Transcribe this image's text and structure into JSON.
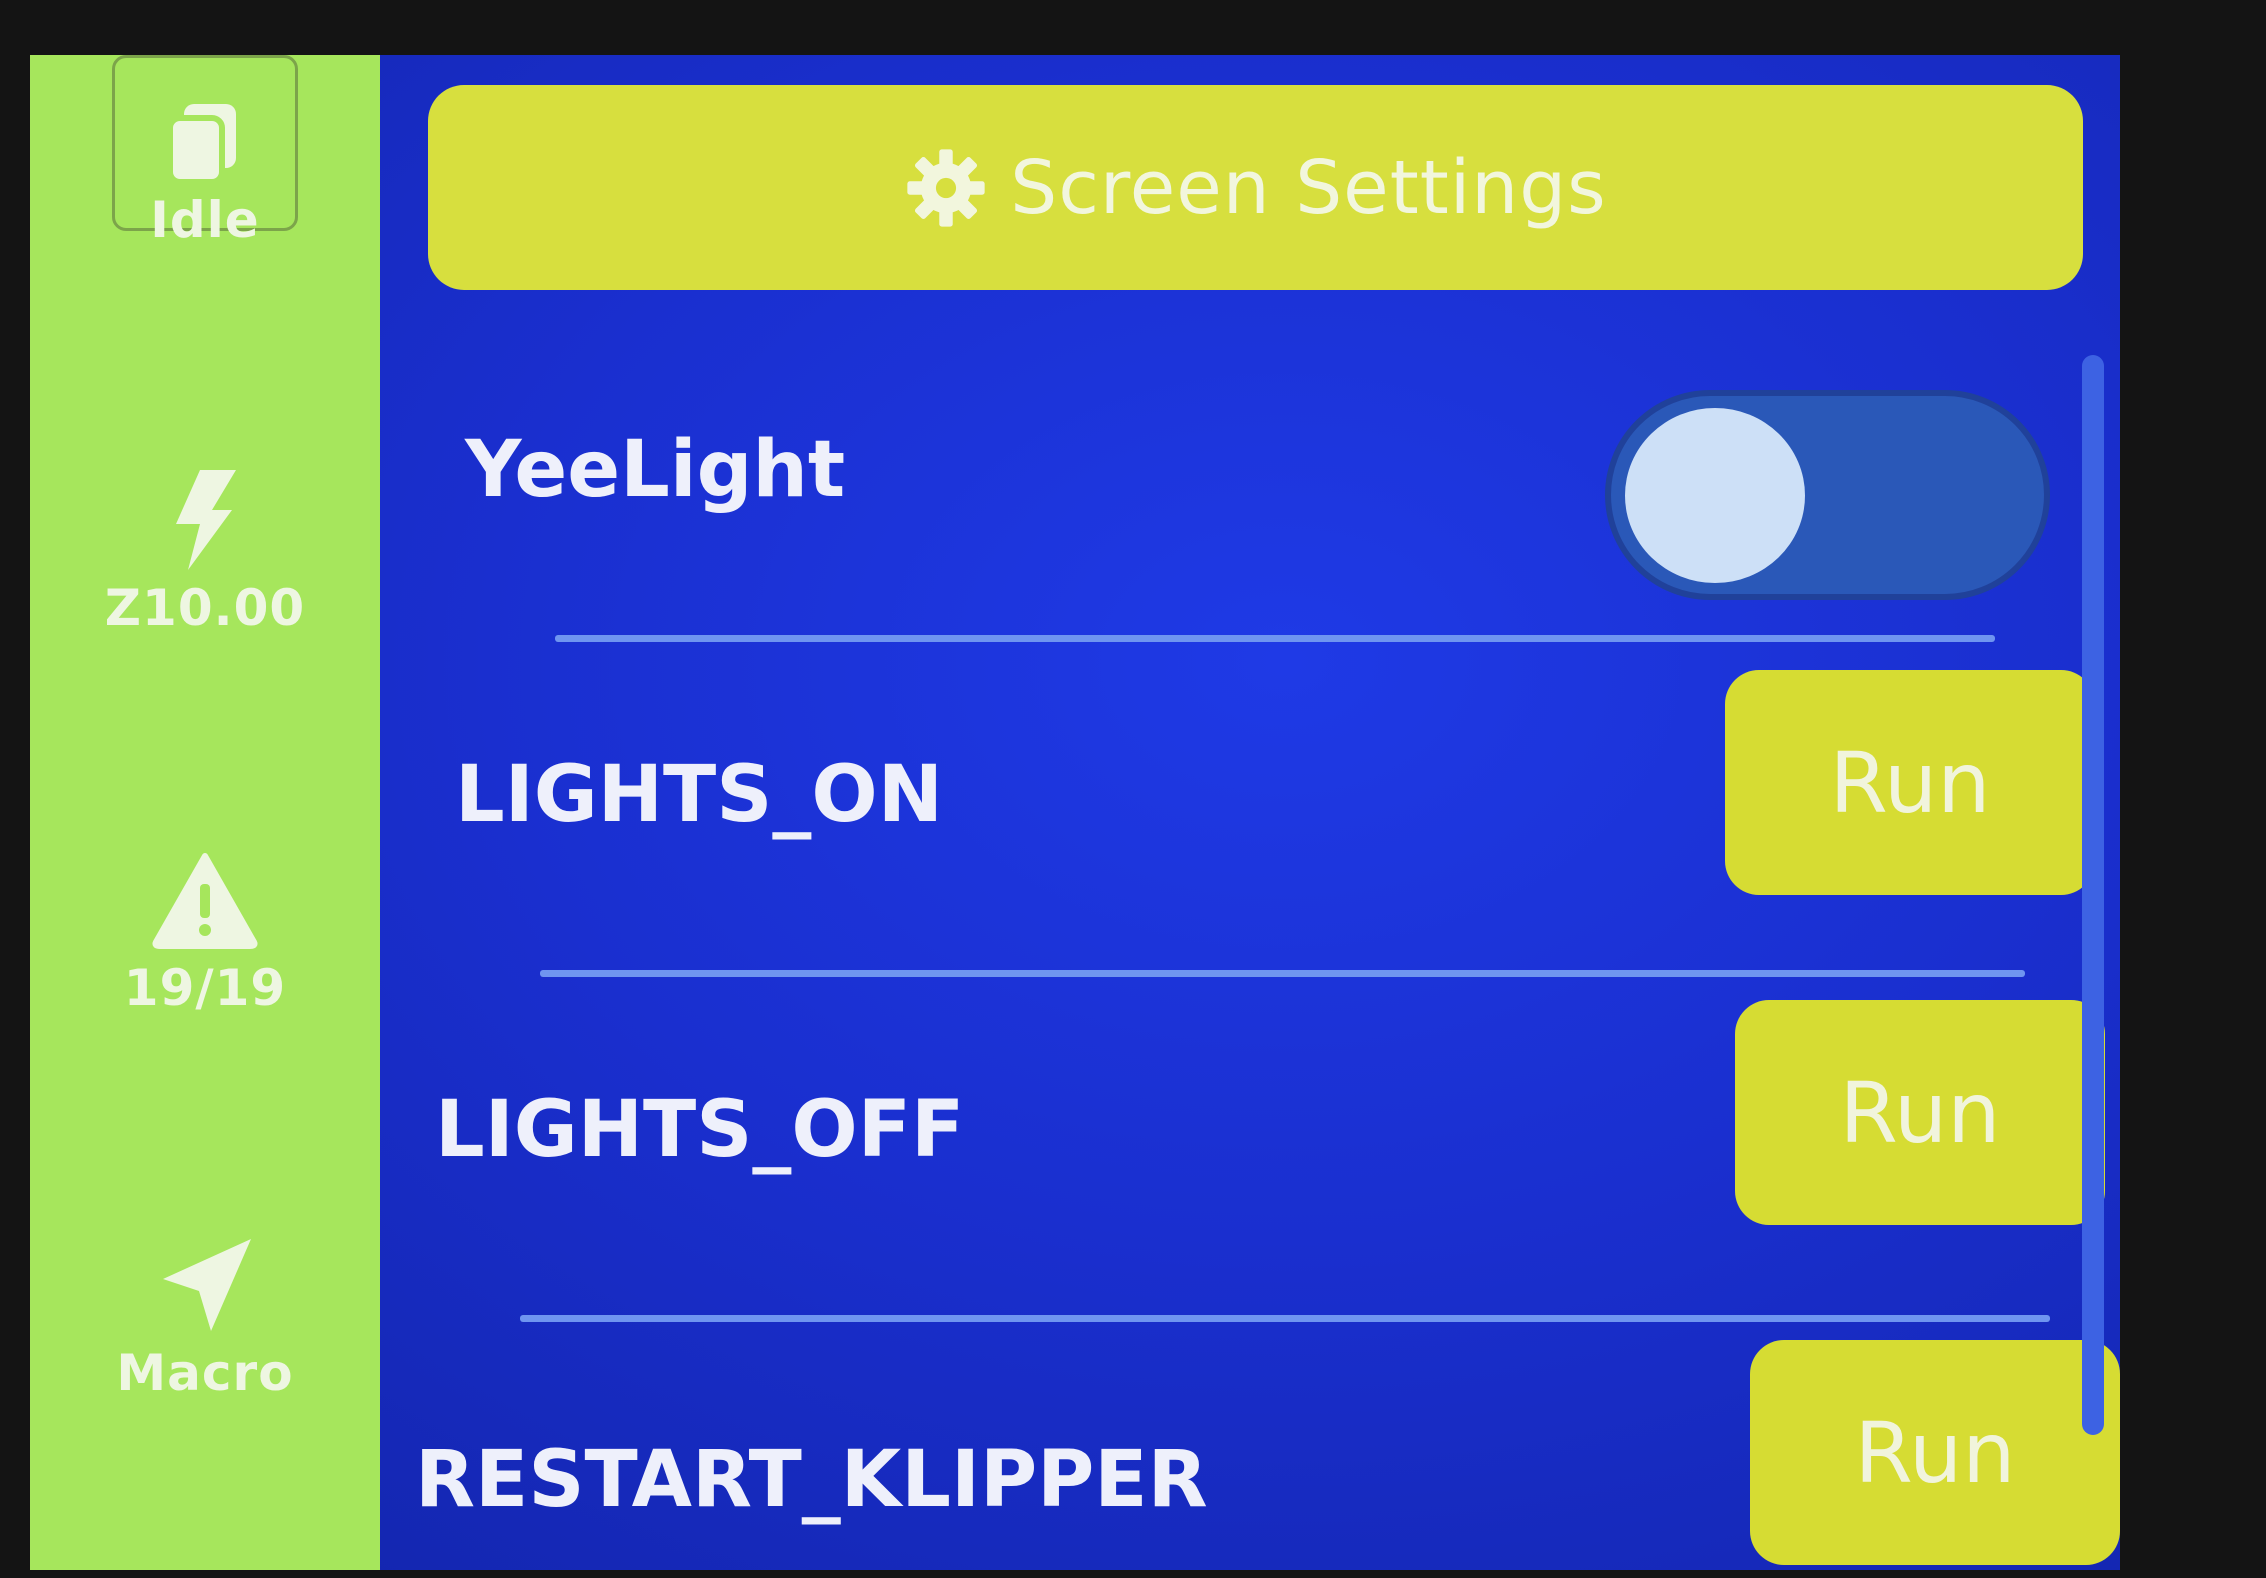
{
  "header": {
    "title": "Screen Settings",
    "icon": "gear-icon"
  },
  "sidebar": {
    "items": [
      {
        "label": "Idle",
        "icon": "files-icon"
      },
      {
        "label": "Z10.00",
        "icon": "lightning-icon"
      },
      {
        "label": "19/19",
        "icon": "warning-icon"
      },
      {
        "label": "Macro",
        "icon": "navigation-arrow-icon"
      }
    ]
  },
  "settings": {
    "toggle_row": {
      "label": "YeeLight",
      "state": "off"
    },
    "macros": [
      {
        "label": "LIGHTS_ON",
        "button": "Run"
      },
      {
        "label": "LIGHTS_OFF",
        "button": "Run"
      },
      {
        "label": "RESTART_KLIPPER",
        "button": "Run"
      }
    ]
  },
  "colors": {
    "sidebar": "#a6e65c",
    "header": "#d7df3e",
    "background": "#1a2fcf",
    "button": "#d6dc33",
    "divider": "#6f95f0"
  }
}
